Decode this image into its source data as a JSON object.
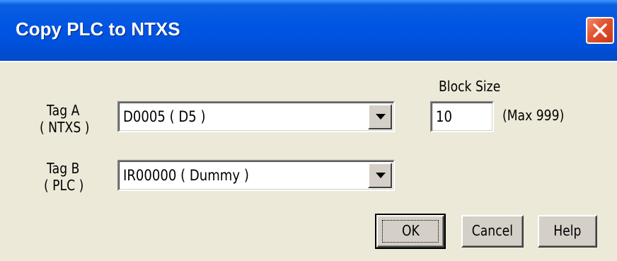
{
  "window": {
    "title": "Copy PLC to NTXS"
  },
  "icons": {
    "close": "close-icon",
    "dropdown": "chevron-down-icon"
  },
  "tag_a": {
    "label_line1": "Tag A",
    "label_line2": "( NTXS )",
    "value": "D0005 ( D5 )"
  },
  "tag_b": {
    "label_line1": "Tag B",
    "label_line2": "( PLC )",
    "value": "IR00000 ( Dummy )"
  },
  "block_size": {
    "label": "Block Size",
    "value": "10",
    "max_note": "(Max 999)"
  },
  "buttons": {
    "ok": "OK",
    "cancel": "Cancel",
    "help": "Help"
  },
  "colors": {
    "title_bar": "#0054e3",
    "dialog_bg": "#ece9d8",
    "close_button": "#e2532f"
  }
}
